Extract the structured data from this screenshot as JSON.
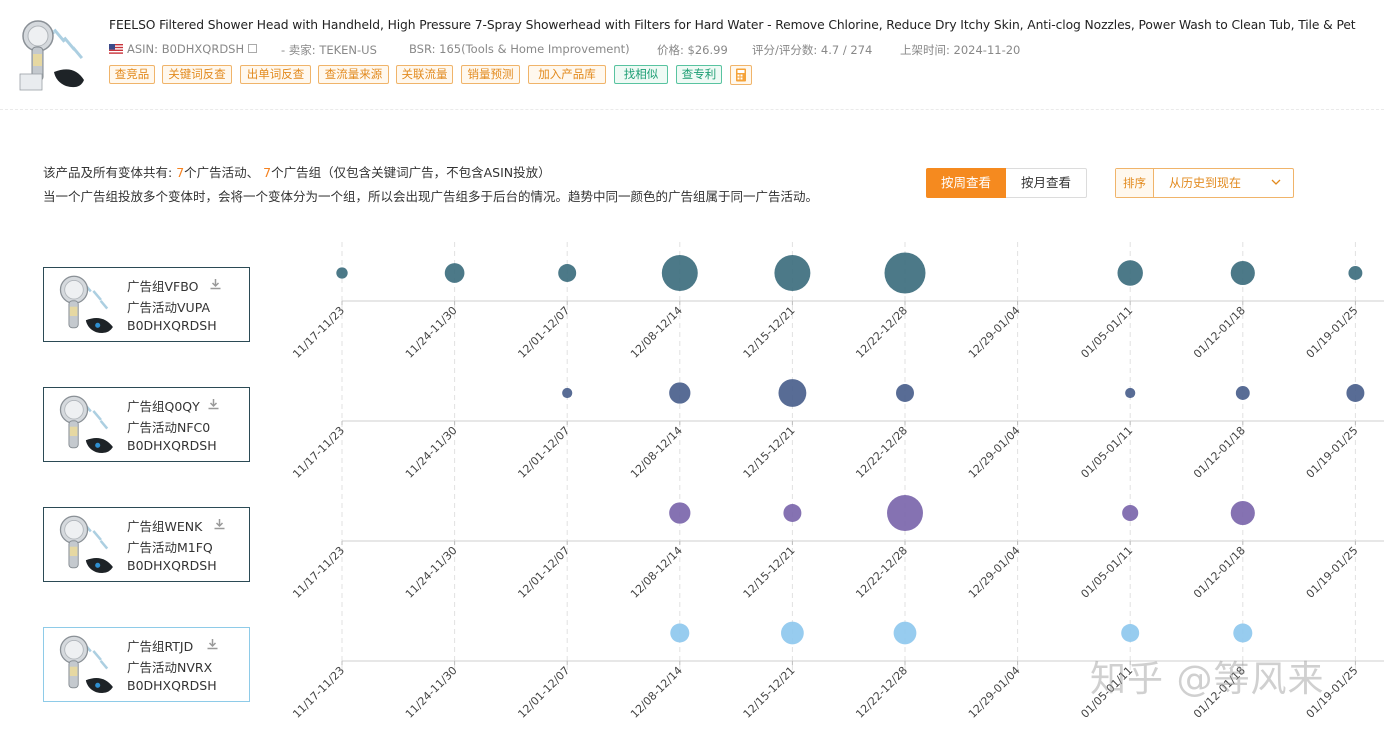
{
  "product": {
    "title": "FEELSO Filtered Shower Head with Handheld, High Pressure 7-Spray Showerhead with Filters for Hard Water - Remove Chlorine, Reduce Dry Itchy Skin, Anti-clog Nozzles, Power Wash to Clean Tub, Tile & Pet",
    "asin": "ASIN: B0DHXQRDSH",
    "seller": "- 卖家: TEKEN-US",
    "bsr": "BSR: 165(Tools & Home Improvement)",
    "price": "价格: $26.99",
    "rating": "评分/评分数: 4.7 / 274",
    "launch": "上架时间: 2024-11-20",
    "tags": [
      "查竞品",
      "关键词反查",
      "出单词反查",
      "查流量来源",
      "关联流量",
      "销量预测",
      "加入产品库",
      "找相似",
      "查专利"
    ]
  },
  "info": {
    "line1_prefix": "该产品及所有变体共有:",
    "campaign_count": "7",
    "line1_mid": "个广告活动、",
    "group_count": "7",
    "line1_suffix": "个广告组（仅包含关键词广告，不包含ASIN投放）",
    "line2": "当一个广告组投放多个变体时，会将一个变体分为一个组，所以会出现广告组多于后台的情况。趋势中同一颜色的广告组属于同一广告活动。"
  },
  "controls": {
    "by_week": "按周查看",
    "by_month": "按月查看",
    "sort_label": "排序",
    "sort_value": "从历史到现在"
  },
  "ad_groups": [
    {
      "group": "广告组VFBO",
      "campaign": "广告活动VUPA",
      "asin": "B0DHXQRDSH"
    },
    {
      "group": "广告组Q0QY",
      "campaign": "广告活动NFC0",
      "asin": "B0DHXQRDSH"
    },
    {
      "group": "广告组WENK",
      "campaign": "广告活动M1FQ",
      "asin": "B0DHXQRDSH"
    },
    {
      "group": "广告组RTJD",
      "campaign": "广告活动NVRX",
      "asin": "B0DHXQRDSH"
    }
  ],
  "chart_data": {
    "type": "scatter",
    "categories": [
      "11/17-11/23",
      "11/24-11/30",
      "12/01-12/07",
      "12/08-12/14",
      "12/15-12/21",
      "12/22-12/28",
      "12/29-01/04",
      "01/05-01/11",
      "01/12-01/18",
      "01/19-01/25"
    ],
    "series": [
      {
        "name": "广告组VFBO",
        "color": "#3d6e7e",
        "values": [
          1,
          3,
          2.5,
          10,
          10,
          13,
          0,
          5,
          4.5,
          1.5
        ]
      },
      {
        "name": "广告组Q0QY",
        "color": "#4a5f8c",
        "values": [
          0,
          0,
          0.8,
          3.5,
          6,
          2.5,
          0,
          0.8,
          1.5,
          2.5
        ]
      },
      {
        "name": "广告组WENK",
        "color": "#7b66ab",
        "values": [
          0,
          0,
          0,
          3.5,
          2.5,
          10,
          0,
          2,
          4.5,
          0
        ]
      },
      {
        "name": "广告组RTJD",
        "color": "#8ec8ee",
        "values": [
          0,
          0,
          0,
          2.8,
          4,
          4,
          0,
          2.5,
          2.8,
          0
        ]
      }
    ],
    "size_encoding": "bubble area",
    "grid": "vertical dashed"
  },
  "watermark": "知乎 @等风来",
  "icons": {
    "flag": "us-flag-icon",
    "external": "external-link-icon",
    "calculator": "calculator-icon",
    "download": "download-icon",
    "dropdown": "chevron-down-icon"
  }
}
